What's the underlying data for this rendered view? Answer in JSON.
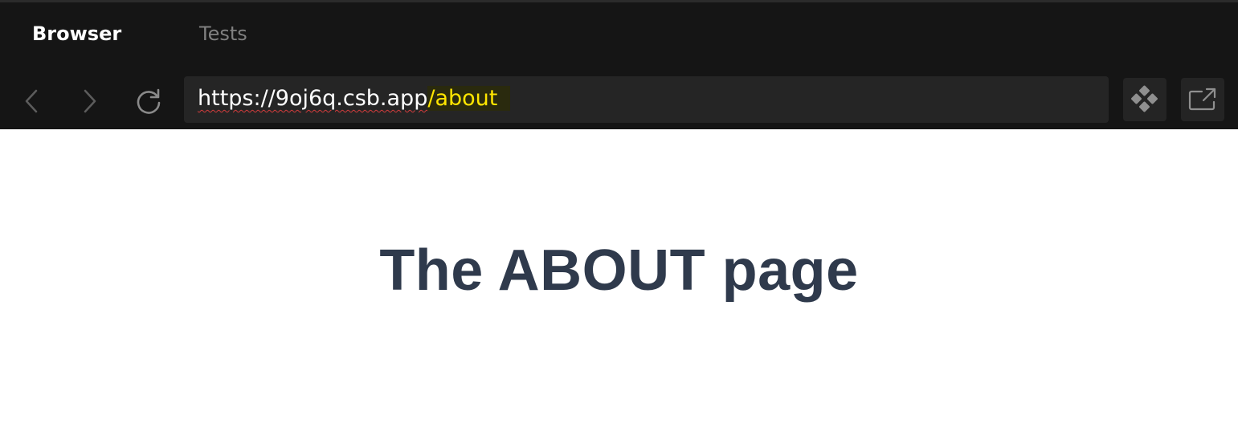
{
  "tabs": [
    {
      "label": "Browser",
      "active": true
    },
    {
      "label": "Tests",
      "active": false
    }
  ],
  "navigation": {
    "back_icon": "chevron-left-icon",
    "forward_icon": "chevron-right-icon",
    "refresh_icon": "refresh-icon"
  },
  "address_bar": {
    "host": "https://9oj6q.csb.app",
    "path": "/about"
  },
  "actions": {
    "devtools_icon": "devtools-icon",
    "open_external_icon": "open-in-new-window-icon"
  },
  "page": {
    "heading": "The ABOUT page"
  },
  "colors": {
    "toolbar_background": "#151515",
    "address_background": "#252525",
    "path_highlight": "#ffe500",
    "heading": "#2f3a4c"
  }
}
